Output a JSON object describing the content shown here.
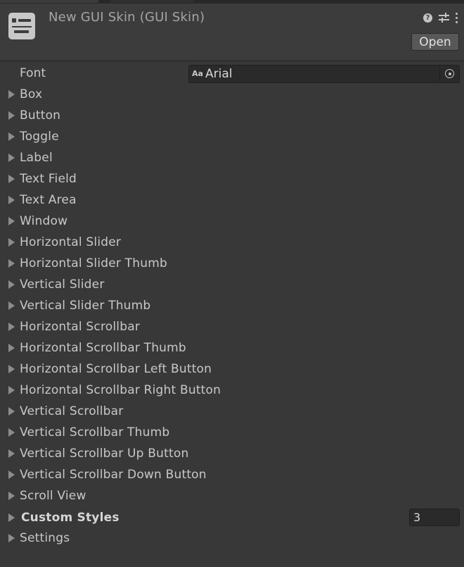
{
  "header": {
    "title": "New GUI Skin (GUI Skin)",
    "open_label": "Open",
    "help_glyph": "?",
    "icons": [
      "gui-skin-asset-icon",
      "help-icon",
      "sliders-icon",
      "kebab-menu-icon"
    ]
  },
  "font_field": {
    "label": "Font",
    "type_glyph": "Aa",
    "value": "Arial"
  },
  "styles": [
    "Box",
    "Button",
    "Toggle",
    "Label",
    "Text Field",
    "Text Area",
    "Window",
    "Horizontal Slider",
    "Horizontal Slider Thumb",
    "Vertical Slider",
    "Vertical Slider Thumb",
    "Horizontal Scrollbar",
    "Horizontal Scrollbar Thumb",
    "Horizontal Scrollbar Left Button",
    "Horizontal Scrollbar Right Button",
    "Vertical Scrollbar",
    "Vertical Scrollbar Thumb",
    "Vertical Scrollbar Up Button",
    "Vertical Scrollbar Down Button",
    "Scroll View"
  ],
  "custom_styles": {
    "label": "Custom Styles",
    "count": "3"
  },
  "settings": {
    "label": "Settings"
  },
  "colors": {
    "background": "#383838",
    "header": "#3c3c3c",
    "field": "#2a2a2a",
    "text": "#c8c8c8"
  }
}
